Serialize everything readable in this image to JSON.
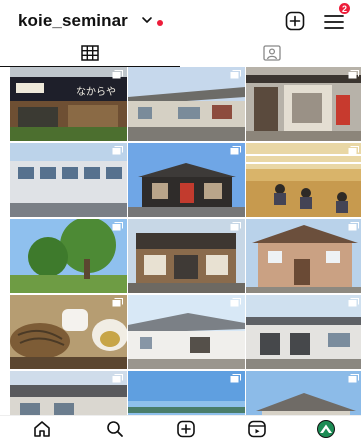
{
  "header": {
    "username": "koie_seminar",
    "notification_badge": "2",
    "accent_color": "#ed1d3a"
  },
  "tabs": [
    {
      "name": "posts-grid",
      "icon": "grid-icon",
      "selected": true
    },
    {
      "name": "tagged",
      "icon": "tagged-person-icon",
      "selected": false
    }
  ],
  "storefront_signs": {
    "tile1_sign": "なからや"
  },
  "grid": {
    "icon": "multiple-photos-icon",
    "tiles": [
      {
        "subject": "storefront-noren"
      },
      {
        "subject": "long-building"
      },
      {
        "subject": "shop-entrance"
      },
      {
        "subject": "building-exterior"
      },
      {
        "subject": "blue-sky-building"
      },
      {
        "subject": "gym-interior"
      },
      {
        "subject": "tree-park"
      },
      {
        "subject": "old-shop"
      },
      {
        "subject": "house"
      },
      {
        "subject": "soba-meal"
      },
      {
        "subject": "white-building"
      },
      {
        "subject": "gray-building"
      },
      {
        "subject": "building-partial"
      },
      {
        "subject": "sky-partial"
      },
      {
        "subject": "roof-partial"
      }
    ]
  },
  "bottom_nav": [
    {
      "name": "home",
      "icon": "home-icon"
    },
    {
      "name": "search",
      "icon": "search-icon"
    },
    {
      "name": "create",
      "icon": "add-post-icon"
    },
    {
      "name": "reels",
      "icon": "reels-icon"
    },
    {
      "name": "profile",
      "icon": "profile-avatar-icon"
    }
  ]
}
